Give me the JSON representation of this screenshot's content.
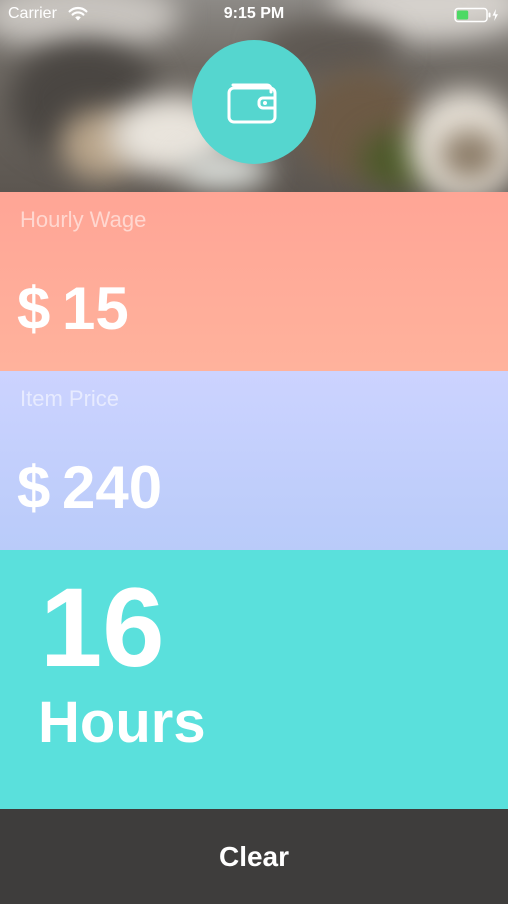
{
  "status_bar": {
    "carrier": "Carrier",
    "time": "9:15 PM",
    "battery_level": 0.4,
    "battery_color": "#4cd964"
  },
  "header": {
    "wallet_icon": "wallet-icon",
    "accent_color": "#55d6cf"
  },
  "hourly_wage": {
    "label": "Hourly Wage",
    "currency": "$",
    "value": "15"
  },
  "item_price": {
    "label": "Item Price",
    "currency": "$",
    "value": "240"
  },
  "result": {
    "value": "16",
    "unit": "Hours"
  },
  "footer": {
    "clear_label": "Clear"
  }
}
